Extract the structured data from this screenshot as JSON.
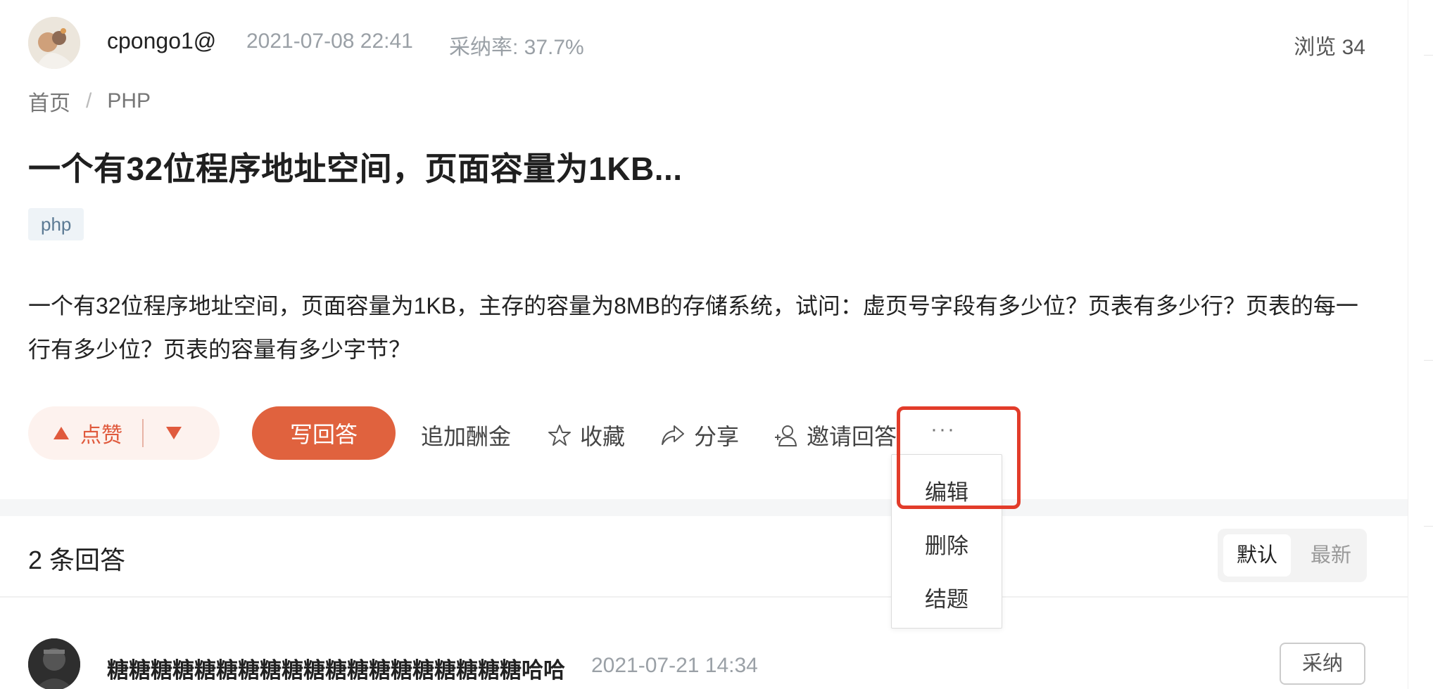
{
  "question": {
    "author": "cpongo1@",
    "date": "2021-07-08 22:41",
    "acceptance_rate": "采纳率: 37.7%",
    "views": "浏览 34",
    "breadcrumb": [
      "首页",
      "/",
      "PHP"
    ],
    "title": "一个有32位程序地址空间，页面容量为1KB...",
    "tag": "php",
    "body": "一个有32位程序地址空间，页面容量为1KB，主存的容量为8MB的存储系统，试问：虚页号字段有多少位？页表有多少行？页表的每一行有多少位？页表的容量有多少字节？"
  },
  "actions": {
    "like_label": "点赞",
    "write_answer": "写回答",
    "add_bounty": "追加酬金",
    "favorite": "收藏",
    "share": "分享",
    "invite": "邀请回答",
    "more": "···"
  },
  "more_menu": {
    "items": [
      "编辑",
      "删除",
      "结题"
    ]
  },
  "answers": {
    "count_label": "2 条回答",
    "sort_options": [
      "默认",
      "最新"
    ],
    "first": {
      "author": "糖糖糖糖糖糖糖糖糖糖糖糖糖糖糖糖糖糖糖哈哈",
      "date": "2021-07-21 14:34",
      "accept_label": "采纳"
    }
  },
  "colors": {
    "accent": "#e0623e",
    "highlight_box": "#e23c2a",
    "muted_text": "#9aa0a6"
  }
}
